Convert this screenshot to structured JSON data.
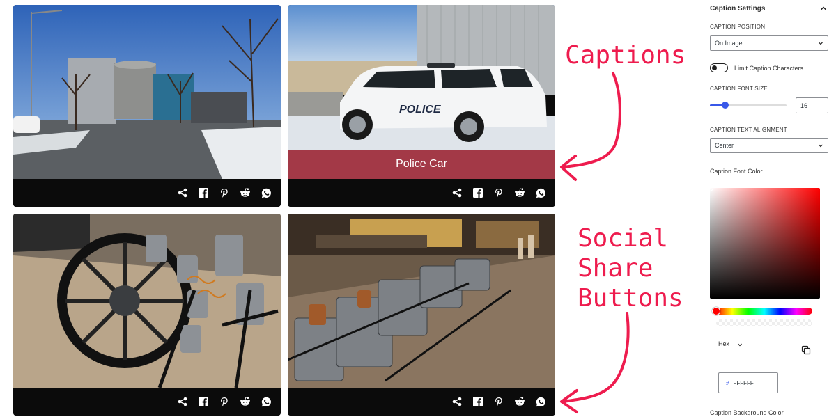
{
  "gallery": {
    "caption_police": "Police Car"
  },
  "share_icons": [
    "share-icon",
    "facebook-icon",
    "pinterest-icon",
    "reddit-icon",
    "whatsapp-icon"
  ],
  "annotations": {
    "captions": "Captions",
    "social_share": "Social\nShare\nButtons",
    "color": "#ee1c4e"
  },
  "sidebar": {
    "title": "Caption Settings",
    "caption_position_label": "CAPTION POSITION",
    "caption_position_value": "On Image",
    "limit_caption_label": "Limit Caption Characters",
    "font_size_label": "CAPTION FONT SIZE",
    "font_size_value": "16",
    "font_size_slider_percent": 20,
    "text_alignment_label": "CAPTION TEXT ALIGNMENT",
    "text_alignment_value": "Center",
    "font_color_label": "Caption Font Color",
    "color_mode": "Hex",
    "hex_value": "FFFFFF",
    "bg_color_label": "Caption Background Color",
    "accent_color": "#3858e9"
  }
}
